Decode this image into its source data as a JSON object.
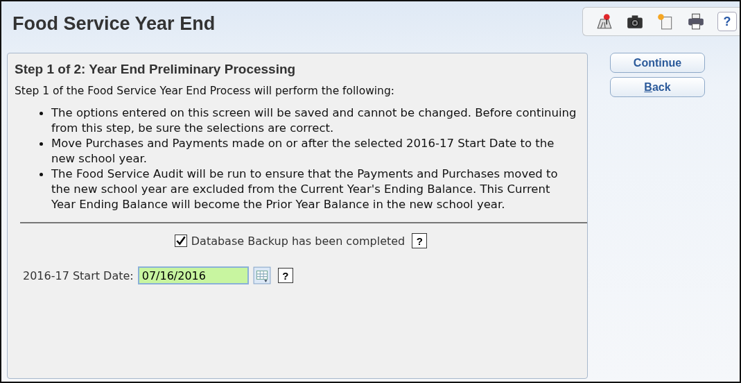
{
  "window": {
    "title": "Food Service Year End"
  },
  "toolbar": [
    {
      "kind": "map"
    },
    {
      "kind": "camera"
    },
    {
      "kind": "note"
    },
    {
      "kind": "print"
    },
    {
      "kind": "help",
      "label": "?"
    }
  ],
  "panel": {
    "heading": "Step 1 of 2: Year End Preliminary Processing",
    "intro": "Step 1 of the Food Service Year End Process will perform the following:",
    "bullets": [
      "The options entered on this screen will be saved and cannot be changed. Before continuing from this step, be sure the selections are correct.",
      "Move Purchases and Payments made on or after the selected 2016-17 Start Date to the new school year.",
      "The Food Service Audit will be run to ensure that the Payments and Purchases moved to the new school year are excluded from the Current Year's Ending Balance. This Current Year Ending Balance will become the Prior Year Balance in the new school year."
    ],
    "backup": {
      "label": "Database Backup has been completed",
      "checked": true,
      "help": "?"
    },
    "start_date": {
      "label": "2016-17 Start Date:",
      "value": "07/16/2016",
      "help": "?"
    }
  },
  "buttons": [
    {
      "label": "Continue",
      "first_letter_underlined": false
    },
    {
      "label": "Back",
      "first_letter_underlined": true
    }
  ]
}
